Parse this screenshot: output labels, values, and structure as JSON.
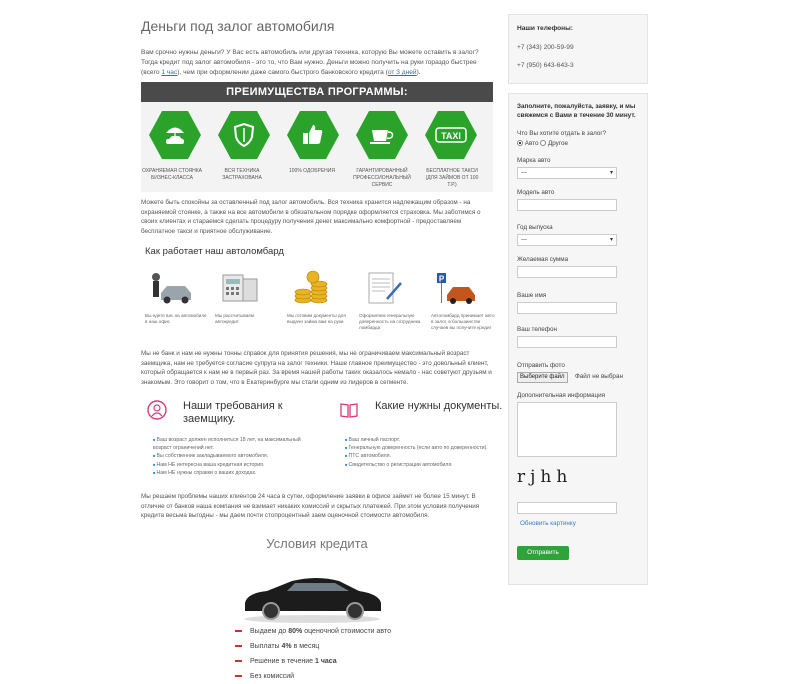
{
  "page": {
    "title": "Деньги под залог автомобиля",
    "intro_1": "Вам срочно нужны деньги? У Вас есть автомобиль или другая техника, которую Вы можете оставить в залог? Тогда кредит под залог автомобиля - это то, что Вам нужно. Деньги можно получить на руки гораздо быстрее (всего ",
    "intro_link_1": "1 час",
    "intro_2": "), чем при оформлении даже самого быстрого банковского кредита (",
    "intro_link_2": "от 3 дней",
    "intro_3": ")."
  },
  "promo": {
    "heading": "ПРЕИМУЩЕСТВА ПРОГРАММЫ:",
    "items": [
      {
        "icon": "umbrella-car-icon",
        "caption": "ОХРАНЯЕМАЯ СТОЯНКА БИЗНЕС-КЛАССА"
      },
      {
        "icon": "shield-icon",
        "caption": "ВСЯ ТЕХНИКА ЗАСТРАХОВАНА"
      },
      {
        "icon": "thumbs-up-icon",
        "caption": "100% ОДОБРЕНИЯ"
      },
      {
        "icon": "coffee-cup-icon",
        "caption": "ГАРАНТИРОВАННЫЙ ПРОФЕССИОНАЛЬНЫЙ СЕРВИС"
      },
      {
        "icon": "taxi-icon",
        "caption": "БЕСПЛАТНОЕ ТАКСИ (ДЛЯ ЗАЙМОВ ОТ 100 Т.Р.)",
        "label": "TAXI"
      }
    ]
  },
  "para_safe": "Можете быть спокойны за оставленный под залог автомобиль. Вся техника хранится надлежащим образом - на охраняемой стоянке, а также на все автомобили в обязательном порядке оформляется страховка. Мы заботимся о своих клиентах и стараемся сделать процедуру получения денег максимально комфортной - предоставляем бесплатное такси и приятное обслуживание.",
  "how": {
    "title": "Как работает наш автоломбард",
    "steps": [
      {
        "icon": "car-owner-icon",
        "caption": "Вы едете вас на автомобиле в наш офис"
      },
      {
        "icon": "calculator-icon",
        "caption": "Мы рассчитываем автокредит"
      },
      {
        "icon": "coins-icon",
        "caption": "Мы готовим документы для выдачи займа вам на руки"
      },
      {
        "icon": "document-pen-icon",
        "caption": "Оформляем генеральную доверенность на сотрудника ломбарда"
      },
      {
        "icon": "parking-icon",
        "caption": "Автоломбард принимает авто в залог, в большинстве случаев вы получите кредит"
      }
    ]
  },
  "para_bank": "Мы не банк и нам не нужны тонны справок для принятия решения, мы не ограничиваем максимальный возраст заемщика, нам не требуется согласие супруга на залог техники. Наше главное преимущество - это довольный клиент, который обращается к нам не в первый раз. За время нашей работы таких оказалось немало - нас советуют друзьям и знакомым. Это говорит о том, что в Екатеринбурге мы стали одним из лидеров в сегменте.",
  "requirements": {
    "title": "Наши требования к заемщику.",
    "items": [
      "Ваш возраст должен исполниться 18 лет, на максимальный возраст ограничений нет.",
      "Вы собственник закладываемого автомобиля.",
      "Нам НЕ интересна ваша кредитная история.",
      "Нам НЕ нужны справки о ваших доходах."
    ]
  },
  "documents": {
    "title": "Какие нужны документы.",
    "items": [
      "Ваш личный паспорт.",
      "Генеральную доверенность (если авто по доверенности).",
      "ПТС автомобиля.",
      "Свидетельство о регистрации автомобиля."
    ]
  },
  "para_quick": "Мы решаем проблемы наших клиентов 24 часа в сутки, оформление заявки в офисе займет не более 15 минут. В отличие от банков наша компания не взимает никаких комиссий и скрытых платежей. При этом условия получения кредита весьма выгодны - мы даем почти стопроцентный заем оценочной стоимости автомобиля.",
  "conditions": {
    "title": "Условия кредита",
    "items": [
      {
        "pre": "Выдаем до ",
        "bold": "80%",
        "post": " оценочной стоимости авто"
      },
      {
        "pre": "Выплаты ",
        "bold": "4%",
        "post": " в месяц"
      },
      {
        "pre": "Решение в течение ",
        "bold": "1 часа",
        "post": ""
      },
      {
        "pre": "Без комиссий",
        "bold": "",
        "post": ""
      }
    ]
  },
  "sidebar": {
    "phones_title": "Наши телефоны:",
    "phones": [
      "+7 (343) 200-59-99",
      "+7 (950) 643-643-3"
    ],
    "form": {
      "heading": "Заполните, пожалуйста, заявку, и мы свяжемся с Вами в течение 30 минут.",
      "q_label": "Что Вы хотите отдать в залог?",
      "opt_auto": "Авто",
      "opt_other": "Другое",
      "brand_label": "Марка авто",
      "brand_value": "---",
      "model_label": "Модель авто",
      "year_label": "Год выпуска",
      "year_value": "---",
      "sum_label": "Желаемая сумма",
      "name_label": "Ваше имя",
      "phone_label": "Ваш телефон",
      "photo_label": "Отправить фото",
      "file_button": "Выберите файл",
      "file_status": "Файл не выбран",
      "info_label": "Дополнительная информация",
      "captcha_text": "rjhh",
      "refresh_link": "Обновить картинку",
      "submit": "Отправить"
    }
  }
}
